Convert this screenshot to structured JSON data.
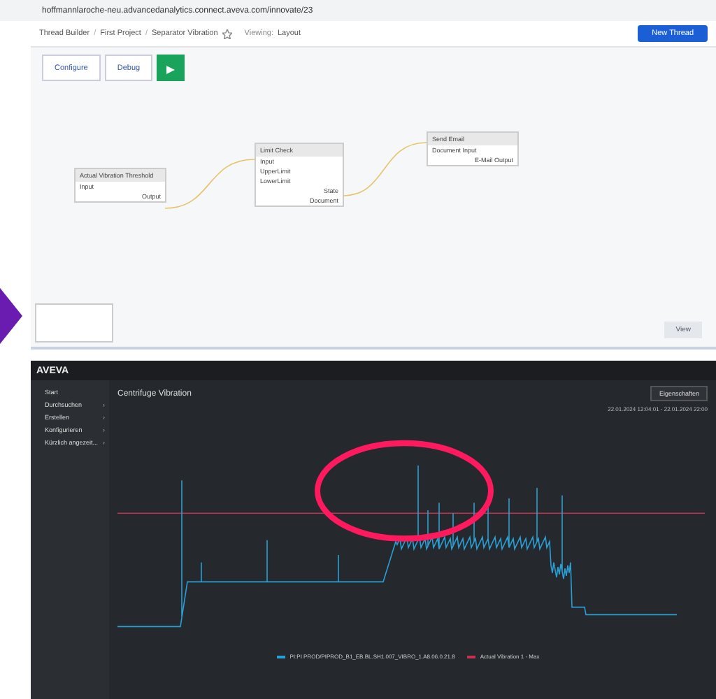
{
  "browser": {
    "url": "hoffmannlaroche-neu.advancedanalytics.connect.aveva.com/innovate/23"
  },
  "thread_builder": {
    "breadcrumb": [
      "Thread Builder",
      "/",
      "First Project",
      "/",
      "Separator Vibration"
    ],
    "viewing_label": "Viewing:",
    "layout_menu": "Layout",
    "new_thread_button": "New Thread",
    "toolbar": [
      {
        "label": "Configure",
        "kind": "configure"
      },
      {
        "label": "Debug",
        "kind": "debug"
      },
      {
        "kind": "run"
      }
    ],
    "nodes": [
      {
        "title": "Actual Vibration Threshold",
        "inputs": [
          "Input"
        ],
        "outputs": [
          "Output"
        ]
      },
      {
        "title": "Limit Check",
        "inputs": [
          "Input",
          "UpperLimit",
          "LowerLimit"
        ],
        "outputs": [
          "State",
          "Document"
        ]
      },
      {
        "title": "Send Email",
        "inputs": [
          "Document Input"
        ],
        "outputs": [
          "E-Mail Output"
        ]
      }
    ],
    "view_button": "View"
  },
  "trend_app": {
    "logo": "AVEVA",
    "sidebar": {
      "items": [
        {
          "label": "Start"
        },
        {
          "label": "Durchsuchen",
          "chevron": "›"
        },
        {
          "label": "Erstellen",
          "chevron": "›"
        },
        {
          "label": "Konfigurieren",
          "chevron": "›"
        },
        {
          "label": "Kürzlich angezeit...",
          "chevron": "›"
        }
      ]
    },
    "title": "Centrifuge Vibration",
    "properties_button": "Eigenschaften",
    "time_range": "22.01.2024 12:04:01 - 22.01.2024 22:00",
    "legend": [
      {
        "name": "PI:PI PROD/PIPROD_B1_EB.BL.SH1.007_VIBRO_1.A8.06.0.21.8",
        "color": "#2a9fd6"
      },
      {
        "name": "Actual Vibration 1 - Max",
        "color": "#c2334d"
      }
    ]
  }
}
